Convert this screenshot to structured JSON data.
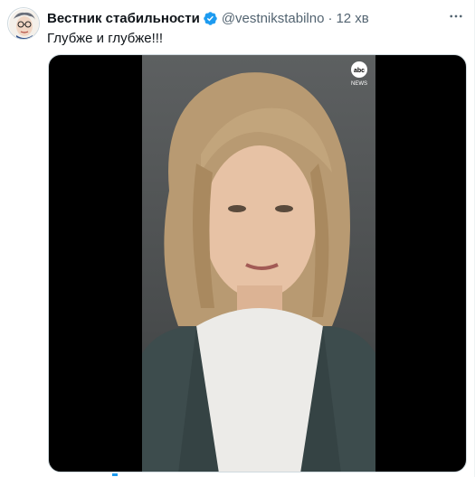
{
  "tweet": {
    "author_name": "Вестник стабильности",
    "handle": "@vestnikstabilno",
    "separator": "·",
    "time": "12 хв",
    "text": "Глубже и глубже!!!",
    "verified_icon": "verified-badge-icon",
    "more_icon": "more-options-icon"
  },
  "media": {
    "type": "video",
    "logo_lines": [
      "abc",
      "NEWS"
    ]
  },
  "colors": {
    "text_primary": "#0f1419",
    "text_secondary": "#536471",
    "verified": "#1d9bf0",
    "media_bg": "#000000"
  }
}
